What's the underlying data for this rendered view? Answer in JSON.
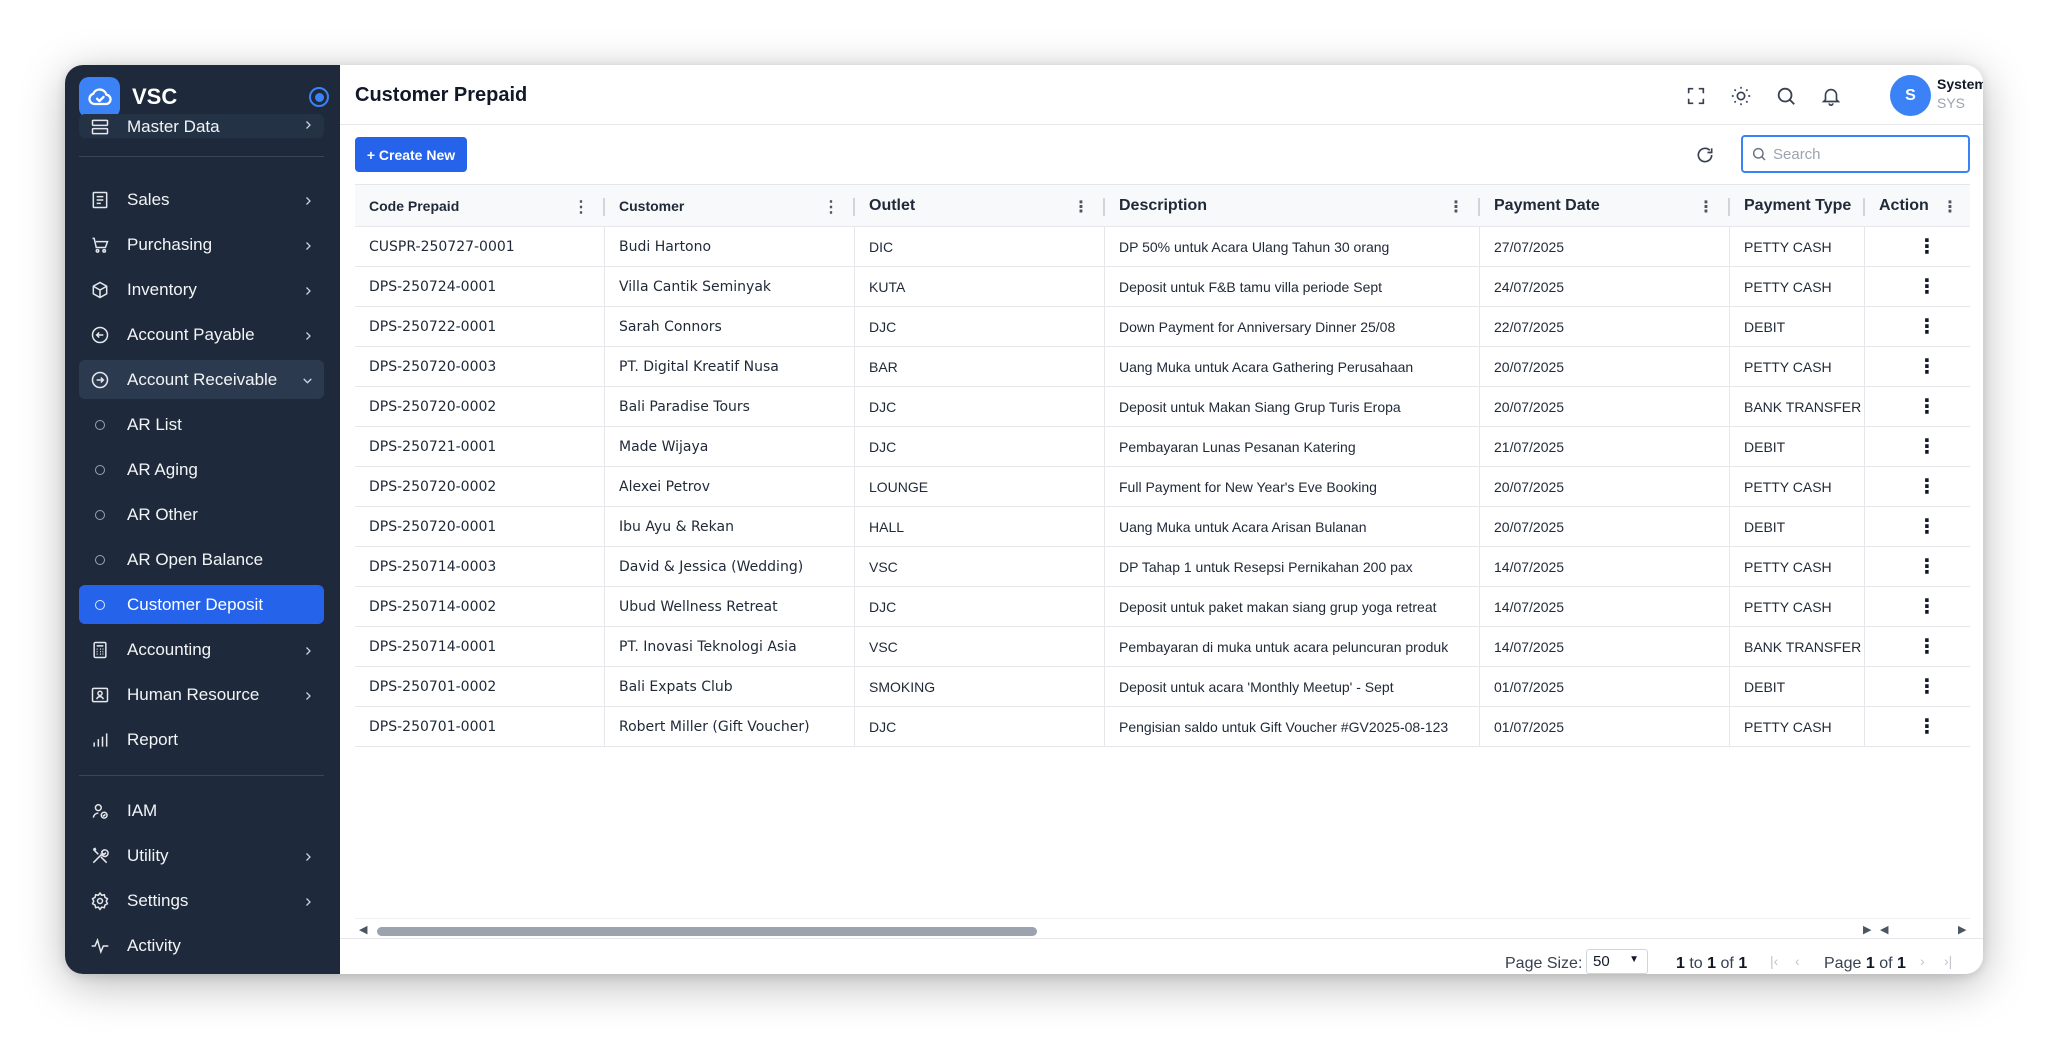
{
  "app": {
    "name": "VSC"
  },
  "sidebar": {
    "clipped_item": "Master Data",
    "items": [
      {
        "label": "Sales",
        "icon": "receipt-icon"
      },
      {
        "label": "Purchasing",
        "icon": "cart-icon"
      },
      {
        "label": "Inventory",
        "icon": "box-icon"
      },
      {
        "label": "Account Payable",
        "icon": "arrow-left-circle-icon"
      },
      {
        "label": "Account Receivable",
        "icon": "arrow-right-circle-icon"
      }
    ],
    "sub_items": [
      "AR List",
      "AR Aging",
      "AR Other",
      "AR Open Balance",
      "Customer Deposit"
    ],
    "items_after": [
      {
        "label": "Accounting",
        "icon": "calculator-icon"
      },
      {
        "label": "Human Resource",
        "icon": "id-card-icon"
      },
      {
        "label": "Report",
        "icon": "bar-chart-icon"
      }
    ],
    "bottom_items": [
      {
        "label": "IAM",
        "icon": "user-shield-icon"
      },
      {
        "label": "Utility",
        "icon": "tools-icon"
      },
      {
        "label": "Settings",
        "icon": "gear-icon"
      },
      {
        "label": "Activity",
        "icon": "activity-icon"
      }
    ]
  },
  "header": {
    "title": "Customer Prepaid",
    "user": {
      "initial": "S",
      "name": "System",
      "code": "SYS"
    }
  },
  "toolbar": {
    "create_label": "+ Create New",
    "search_placeholder": "Search"
  },
  "table": {
    "columns": [
      "Code Prepaid",
      "Customer",
      "Outlet",
      "Description",
      "Payment Date",
      "Payment Type",
      "Action"
    ],
    "rows": [
      [
        "CUSPR-250727-0001",
        "Budi Hartono",
        "DIC",
        "DP 50% untuk Acara Ulang Tahun 30 orang",
        "27/07/2025",
        "PETTY CASH"
      ],
      [
        "DPS-250724-0001",
        "Villa Cantik Seminyak",
        "KUTA",
        "Deposit untuk F&B tamu villa periode Sept",
        "24/07/2025",
        "PETTY CASH"
      ],
      [
        "DPS-250722-0001",
        "Sarah Connors",
        "DJC",
        "Down Payment for Anniversary Dinner 25/08",
        "22/07/2025",
        "DEBIT"
      ],
      [
        "DPS-250720-0003",
        "PT. Digital Kreatif Nusa",
        "BAR",
        "Uang Muka untuk Acara Gathering Perusahaan",
        "20/07/2025",
        "PETTY CASH"
      ],
      [
        "DPS-250720-0002",
        "Bali Paradise Tours",
        "DJC",
        "Deposit untuk Makan Siang Grup Turis Eropa",
        "20/07/2025",
        "BANK TRANSFER"
      ],
      [
        "DPS-250721-0001",
        "Made Wijaya",
        "DJC",
        "Pembayaran Lunas Pesanan Katering",
        "21/07/2025",
        "DEBIT"
      ],
      [
        "DPS-250720-0002",
        "Alexei Petrov",
        "LOUNGE",
        "Full Payment for New Year's Eve Booking",
        "20/07/2025",
        "PETTY CASH"
      ],
      [
        "DPS-250720-0001",
        "Ibu Ayu & Rekan",
        "HALL",
        "Uang Muka untuk Acara Arisan Bulanan",
        "20/07/2025",
        "DEBIT"
      ],
      [
        "DPS-250714-0003",
        "David & Jessica (Wedding)",
        "VSC",
        "DP Tahap 1 untuk Resepsi Pernikahan 200 pax",
        "14/07/2025",
        "PETTY CASH"
      ],
      [
        "DPS-250714-0002",
        "Ubud Wellness Retreat",
        "DJC",
        "Deposit untuk paket makan siang grup yoga retreat",
        "14/07/2025",
        "PETTY CASH"
      ],
      [
        "DPS-250714-0001",
        "PT. Inovasi Teknologi Asia",
        "VSC",
        "Pembayaran di muka untuk acara peluncuran produk",
        "14/07/2025",
        "BANK TRANSFER"
      ],
      [
        "DPS-250701-0002",
        "Bali Expats Club",
        "SMOKING",
        "Deposit untuk acara 'Monthly Meetup' - Sept",
        "01/07/2025",
        "DEBIT"
      ],
      [
        "DPS-250701-0001",
        "Robert Miller (Gift Voucher)",
        "DJC",
        "Pengisian saldo untuk Gift Voucher #GV2025-08-123",
        "01/07/2025",
        "PETTY CASH"
      ]
    ]
  },
  "pagination": {
    "page_size_label": "Page Size:",
    "page_size": "50",
    "range_from": "1",
    "range_sep": "to",
    "range_to": "1",
    "range_of": "of",
    "range_total": "1",
    "page_word": "Page",
    "page_current": "1",
    "page_of": "of",
    "page_total": "1"
  },
  "colors": {
    "sidebar_bg": "#1e2a3b",
    "accent": "#2563eb",
    "active_item": "#2563eb"
  }
}
